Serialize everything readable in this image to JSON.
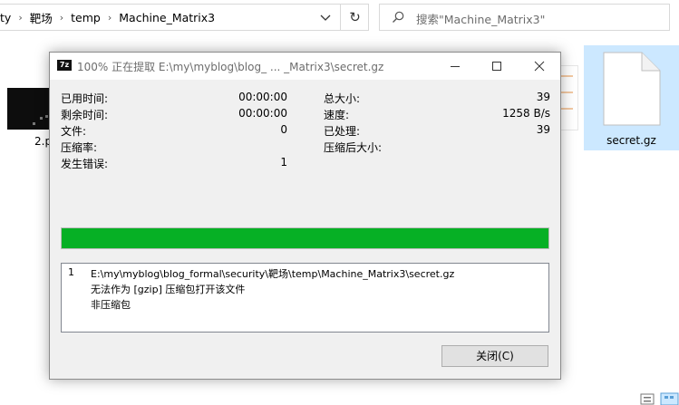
{
  "explorer": {
    "breadcrumb": [
      "ty",
      "靶场",
      "temp",
      "Machine_Matrix3"
    ],
    "search_placeholder": "搜索\"Machine_Matrix3\"",
    "files": [
      {
        "name": "2.p",
        "icon": "image-thumbnail-icon"
      },
      {
        "name": "secret.gz",
        "icon": "file-icon",
        "selected": true
      }
    ]
  },
  "dialog": {
    "title": "100% 正在提取 E:\\my\\myblog\\blog_ ... _Matrix3\\secret.gz",
    "app_icon_text": "7z",
    "stats_left": [
      {
        "label": "已用时间:",
        "value": "00:00:00"
      },
      {
        "label": "剩余时间:",
        "value": "00:00:00"
      },
      {
        "label": "文件:",
        "value": "0"
      },
      {
        "label": "压缩率:",
        "value": ""
      },
      {
        "label": "发生错误:",
        "value": "1"
      }
    ],
    "stats_right": [
      {
        "label": "总大小:",
        "value": "39"
      },
      {
        "label": "速度:",
        "value": "1258 B/s"
      },
      {
        "label": "已处理:",
        "value": "39"
      },
      {
        "label": "压缩后大小:",
        "value": ""
      }
    ],
    "progress_percent": 100,
    "progress_color": "#06b025",
    "log": {
      "number": "1",
      "lines": [
        "E:\\my\\myblog\\blog_formal\\security\\靶场\\temp\\Machine_Matrix3\\secret.gz",
        "无法作为 [gzip] 压缩包打开该文件",
        "非压缩包"
      ]
    },
    "close_label": "关闭(C)"
  }
}
